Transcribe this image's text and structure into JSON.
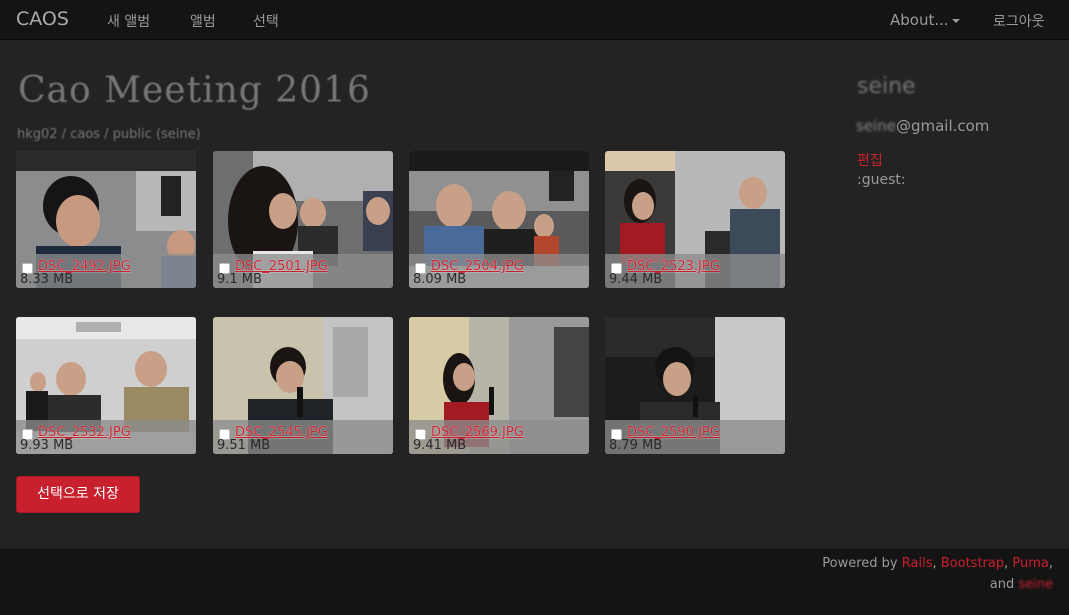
{
  "navbar": {
    "brand": "CAOS",
    "links": [
      "새 앨범",
      "앨범",
      "선택"
    ],
    "about": "About...",
    "logout": "로그아웃"
  },
  "album": {
    "title": "Cao Meeting 2016",
    "path": "hkg02 / caos / public (seine)"
  },
  "photos": [
    {
      "name": "DSC_2492.JPG",
      "size": "8.33 MB"
    },
    {
      "name": "DSC_2501.JPG",
      "size": "9.1 MB"
    },
    {
      "name": "DSC_2504.JPG",
      "size": "8.09 MB"
    },
    {
      "name": "DSC_2523.JPG",
      "size": "9.44 MB"
    },
    {
      "name": "DSC_2532.JPG",
      "size": "9.93 MB"
    },
    {
      "name": "DSC_2545.JPG",
      "size": "9.51 MB"
    },
    {
      "name": "DSC_2569.JPG",
      "size": "9.41 MB"
    },
    {
      "name": "DSC_2590.JPG",
      "size": "8.79 MB"
    }
  ],
  "save_button": "선택으로 저장",
  "sidebar": {
    "name": "seine",
    "email_user": "seine",
    "email_domain": "@gmail.com",
    "edit": "편집",
    "role": ":guest:"
  },
  "footer": {
    "powered_by": "Powered by ",
    "rails": "Rails",
    "bootstrap": "Bootstrap",
    "puma": "Puma",
    "and": "and ",
    "author": "seine"
  },
  "colors": {
    "accent": "#c9202e",
    "background": "#232323",
    "navbar": "#141414"
  }
}
